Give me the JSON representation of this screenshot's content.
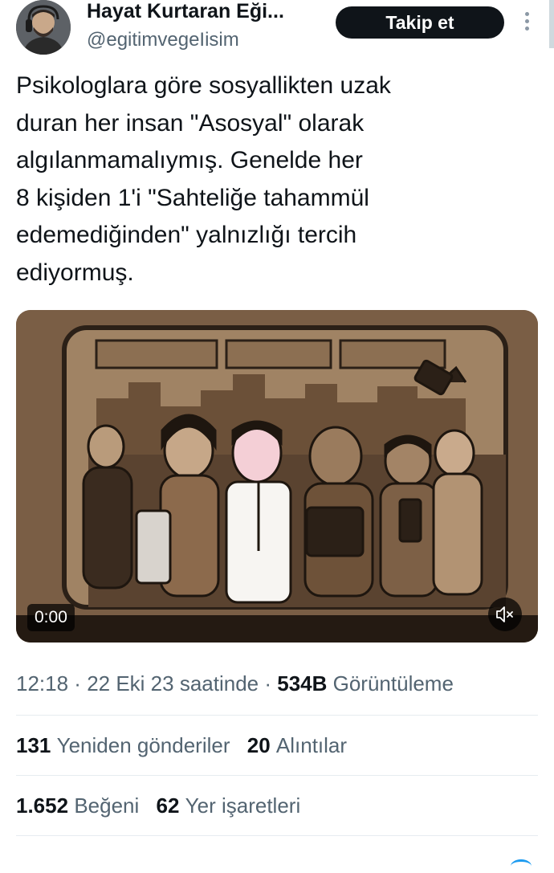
{
  "author": {
    "name": "Hayat Kurtaran Eği...",
    "handle": "@egitimvegeIisim",
    "follow_label": "Takip et"
  },
  "tweet": {
    "lines": [
      "Psikologlara göre sosyallikten uzak",
      "duran her insan \"Asosyal\" olarak",
      "algılanmamalıymış. Genelde her",
      "8 kişiden 1'i \"Sahteliğe tahammül",
      "edemediğinden\" yalnızlığı tercih",
      "ediyormuş."
    ]
  },
  "video": {
    "time": "0:00",
    "mute_icon": "speaker-muted-icon"
  },
  "meta": {
    "time": "12:18",
    "sep1": " · ",
    "date": "22 Eki 23 saatinde",
    "sep2": " · ",
    "views": "534B",
    "views_label": "Görüntüleme"
  },
  "stats": {
    "reposts": "131",
    "reposts_label": "Yeniden gönderiler",
    "quotes": "20",
    "quotes_label": "Alıntılar",
    "likes": "1.652",
    "likes_label": "Beğeni",
    "bookmarks": "62",
    "bookmarks_label": "Yer işaretleri"
  },
  "colors": {
    "text": "#0f1419",
    "secondary": "#536471",
    "button": "#0f1419",
    "media_bg": "#7a5e45"
  }
}
